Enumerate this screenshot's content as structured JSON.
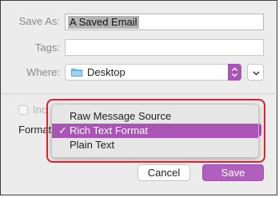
{
  "save_as": {
    "label": "Save As:",
    "value": "A Saved Email"
  },
  "tags": {
    "label": "Tags:",
    "value": ""
  },
  "where": {
    "label": "Where:",
    "value": "Desktop",
    "icon": "folder-icon"
  },
  "include": {
    "label": "Inc"
  },
  "format": {
    "label": "Format",
    "options": [
      "Raw Message Source",
      "Rich Text Format",
      "Plain Text"
    ],
    "selected": "Rich Text Format",
    "check_glyph": "✓"
  },
  "buttons": {
    "cancel": "Cancel",
    "save": "Save"
  },
  "colors": {
    "accent": "#a855b5",
    "highlight": "#e0202a"
  }
}
